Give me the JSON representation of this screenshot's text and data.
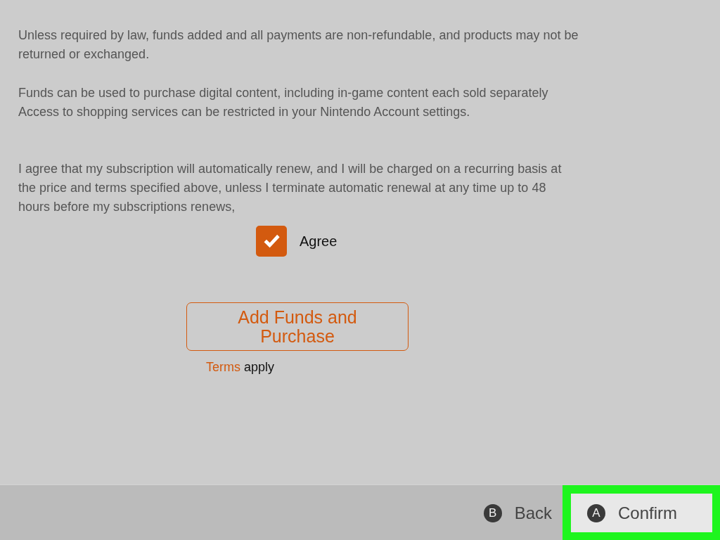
{
  "paragraphs": [
    {
      "text": "Unless required by law, funds added and all payments are non-refundable, and products may not be returned or exchanged."
    },
    {
      "text": "Funds can be used to purchase digital content, including in-game content each sold separately\nAccess to shopping services can be restricted in your Nintendo Account settings."
    },
    {
      "text": "I agree that my subscription will automatically renew, and I will be charged on a recurring basis at the price and terms specified above, unless I terminate automatic renewal at any time up to 48 hours before my subscriptions renews,"
    }
  ],
  "agreement": {
    "label": "Agree",
    "checked": true
  },
  "purchase_button": {
    "label": "Add Funds and Purchase"
  },
  "terms_note": {
    "link": "Terms",
    "text": "apply"
  },
  "footer_buttons": [
    {
      "key": "B",
      "label": "Back",
      "selected": false,
      "highlighted": false
    },
    {
      "key": "A",
      "label": "Confirm",
      "selected": true,
      "highlighted": true
    }
  ]
}
